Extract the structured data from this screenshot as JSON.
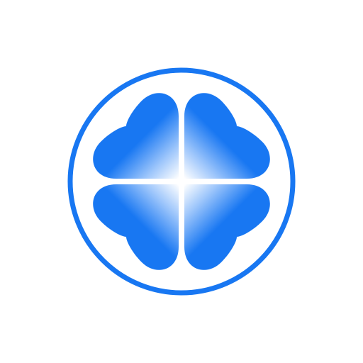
{
  "logo": {
    "icon_name": "four-leaf-clover-icon",
    "colors": {
      "brand": "#1877F2",
      "background": "#FFFFFF",
      "highlight": "#FFFFFF"
    }
  }
}
